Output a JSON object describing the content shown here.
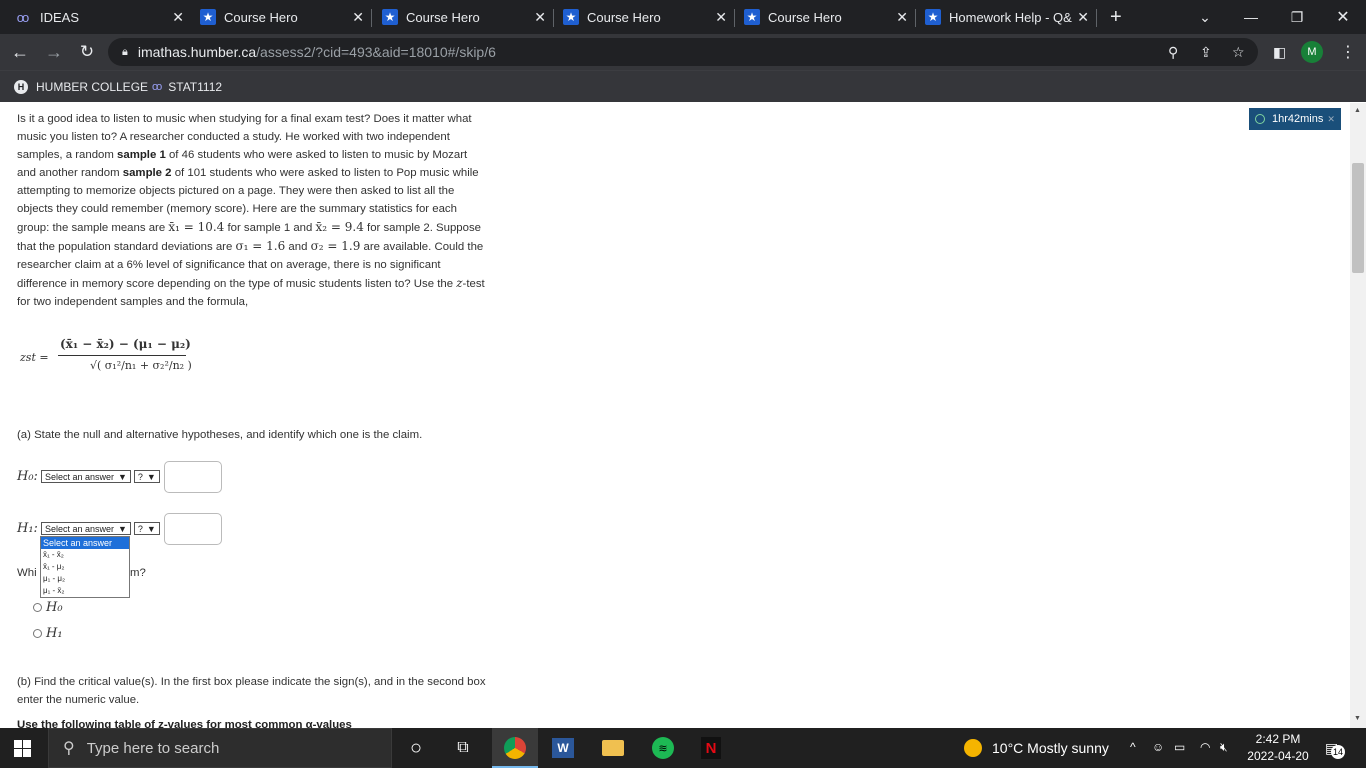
{
  "browser": {
    "tabs": [
      {
        "title": "IDEAS",
        "icon": "ideas-icon"
      },
      {
        "title": "Course Hero",
        "icon": "star-icon"
      },
      {
        "title": "Course Hero",
        "icon": "star-icon"
      },
      {
        "title": "Course Hero",
        "icon": "star-icon"
      },
      {
        "title": "Course Hero",
        "icon": "star-icon"
      },
      {
        "title": "Homework Help - Q&",
        "icon": "star-icon"
      }
    ],
    "url_host": "imathas.humber.ca",
    "url_path": "/assess2/?cid=493&aid=18010#/skip/6",
    "profile_initial": "M",
    "bookmarks": [
      {
        "label": "HUMBER COLLEGE",
        "icon": "humber-icon"
      },
      {
        "label": "STAT1112",
        "icon": "ideas-icon"
      }
    ]
  },
  "timer": {
    "label": "1hr42mins"
  },
  "question": {
    "p1": "Is it a good idea to listen to music when studying for a final exam test? Does it matter what music you listen to? A researcher conducted a study. He worked with two independent samples, a random ",
    "s1": "sample 1",
    "p2": " of 46 students who were asked to listen to music by Mozart and another random ",
    "s2": "sample 2",
    "p3": " of 101 students who were asked to listen to Pop music while attempting to memorize objects pictured on a page. They were then asked to list all the objects they could remember (memory score). Here are the summary statistics for each group: the sample means are ",
    "m1": "x̄₁ = 10.4",
    "p4": " for sample 1 and ",
    "m2": "x̄₂ = 9.4",
    "p5": " for sample 2. Suppose that the population standard deviations are ",
    "m3": "σ₁ = 1.6",
    "p6": " and ",
    "m4": "σ₂ = 1.9",
    "p7": " are available. Could the researcher claim at a 6% level of significance that on average, there is no significant difference in memory score depending on the type of music students listen to? Use the ",
    "m5": "z",
    "p8": "-test for two independent samples and the formula,"
  },
  "formula": {
    "lhs": "zst =",
    "numerator": "(x̄₁ − x̄₂) − (μ₁ − μ₂)",
    "denominator": "√( σ₁²/n₁ + σ₂²/n₂ )"
  },
  "partA": {
    "prompt": "(a) State the null and alternative hypotheses, and identify which one is the claim.",
    "h0_label": "H₀:",
    "h1_label": "H₁:",
    "select_placeholder": "Select an answer",
    "op_placeholder": "?",
    "dropdown_options": [
      "Select an answer",
      "x̄₁ - x̄₂",
      "x̄₁ - μ₂",
      "μ₁ - μ₂",
      "μ₁ - x̄₂"
    ],
    "which_prefix": "Whi",
    "which_suffix": "m?",
    "radio_h0": "H₀",
    "radio_h1": "H₁"
  },
  "partB": {
    "prompt": "(b) Find the critical value(s). In the first box please indicate the sign(s), and in the second box enter the numeric value.",
    "cutoff": "Use the following table of z-values for most common α-values"
  },
  "taskbar": {
    "search_placeholder": "Type here to search",
    "weather": "10°C  Mostly sunny",
    "time": "2:42 PM",
    "date": "2022-04-20",
    "notifications": "14"
  }
}
